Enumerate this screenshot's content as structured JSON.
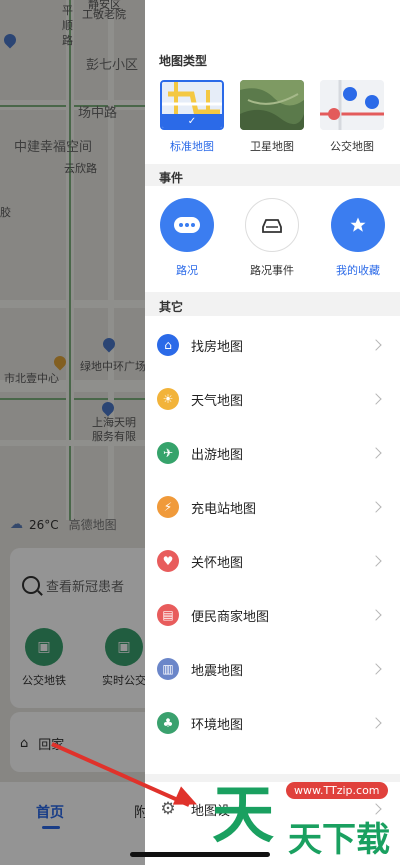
{
  "map": {
    "labels": [
      "平",
      "顺",
      "路",
      "静安区",
      "工敬老院",
      "彭七小区",
      "场中路",
      "中建幸福空间",
      "云欣路",
      "绿地中环广场",
      "市北壹中心",
      "上海天明",
      "服务有限",
      "胶"
    ],
    "weather_temp": "26°C",
    "weather_extra": "高德地图",
    "search_placeholder": "查看新冠患者",
    "quick_actions": [
      "公交地铁",
      "实时公交"
    ],
    "home_label": "回家",
    "nav": [
      "首页",
      "附"
    ]
  },
  "panel": {
    "sections": {
      "map_type": "地图类型",
      "events": "事件",
      "other": "其它"
    },
    "map_types": [
      {
        "label": "标准地图",
        "active": true
      },
      {
        "label": "卫星地图",
        "active": false
      },
      {
        "label": "公交地图",
        "active": false
      }
    ],
    "events": [
      {
        "label": "路况",
        "style": "blue"
      },
      {
        "label": "路况事件",
        "style": "white"
      },
      {
        "label": "我的收藏",
        "style": "blue"
      }
    ],
    "other_items": [
      {
        "label": "找房地图",
        "icon": "house-pin-icon",
        "color": "#2b6ae8"
      },
      {
        "label": "天气地图",
        "icon": "weather-icon",
        "color": "#f2b33a"
      },
      {
        "label": "出游地图",
        "icon": "travel-icon",
        "color": "#36a36b"
      },
      {
        "label": "充电站地图",
        "icon": "charging-icon",
        "color": "#f09a3a"
      },
      {
        "label": "关怀地图",
        "icon": "heart-icon",
        "color": "#e85c5c"
      },
      {
        "label": "便民商家地图",
        "icon": "shop-icon",
        "color": "#e85c5c"
      },
      {
        "label": "地震地图",
        "icon": "earthquake-icon",
        "color": "#6b86c9"
      },
      {
        "label": "环境地图",
        "icon": "tree-icon",
        "color": "#3aa16e"
      },
      {
        "label": "地图设",
        "icon": "gear-icon",
        "color": "#666666"
      }
    ]
  },
  "watermark": {
    "url": "www.TTzip.com",
    "big": "天",
    "small": "天下载"
  }
}
